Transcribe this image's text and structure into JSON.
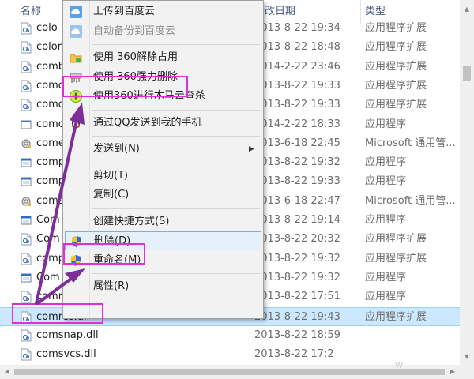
{
  "columns": {
    "name": "名称",
    "date": "修改日期",
    "type": "类型"
  },
  "files": [
    {
      "name": "colo",
      "date": "2013-8-22 19:34",
      "type": "应用程序扩展",
      "icon": "dll-icon"
    },
    {
      "name": "color",
      "date": "2013-8-22 18:48",
      "type": "应用程序扩展",
      "icon": "dll-icon"
    },
    {
      "name": "comb",
      "date": "2014-2-22 23:46",
      "type": "应用程序扩展",
      "icon": "dll-icon"
    },
    {
      "name": "comc",
      "date": "2013-8-22 19:33",
      "type": "应用程序扩展",
      "icon": "dll-icon"
    },
    {
      "name": "comc",
      "date": "2013-8-22 19:33",
      "type": "应用程序扩展",
      "icon": "dll-icon"
    },
    {
      "name": "comc",
      "date": "2014-2-22 18:33",
      "type": "应用程序",
      "icon": "exe-icon"
    },
    {
      "name": "come",
      "date": "2013-6-18 22:45",
      "type": "Microsoft 通用管...",
      "icon": "gear-file-icon"
    },
    {
      "name": "comp",
      "date": "2013-8-22 19:32",
      "type": "应用程序",
      "icon": "window-icon"
    },
    {
      "name": "comp",
      "date": "2013-8-22 19:33",
      "type": "应用程序",
      "icon": "window-icon"
    },
    {
      "name": "coms",
      "date": "2013-6-18 22:47",
      "type": "Microsoft 通用管...",
      "icon": "gear-file-icon"
    },
    {
      "name": "Com",
      "date": "2013-8-22 19:14",
      "type": "应用程序",
      "icon": "window-icon"
    },
    {
      "name": "Com",
      "date": "2013-8-22 20:32",
      "type": "应用程序扩展",
      "icon": "dll-icon"
    },
    {
      "name": "comp",
      "date": "2013-8-22 19:32",
      "type": "应用程序扩展",
      "icon": "dll-icon"
    },
    {
      "name": "Com",
      "date": "2013-8-22 19:32",
      "type": "应用程序",
      "icon": "window-icon"
    },
    {
      "name": "comr",
      "date": "2013-8-22 17:51",
      "type": "应用程序",
      "icon": "dll-icon"
    },
    {
      "name": "comres.dll",
      "date": "2013-8-22 19:43",
      "type": "应用程序扩展",
      "icon": "dll-icon",
      "selected": true
    },
    {
      "name": "comsnap.dll",
      "date": "2013-8-22 18:59",
      "type": "",
      "icon": "dll-icon"
    },
    {
      "name": "comsvcs.dll",
      "date": "2013-8-22 17:2",
      "type": "",
      "icon": "dll-icon"
    }
  ],
  "context_menu": {
    "items": [
      {
        "label": "上传到百度云",
        "icon": "baidu-cloud-icon"
      },
      {
        "label": "自动备份到百度云",
        "icon": "baidu-backup-icon",
        "disabled": true
      },
      {
        "sep": true
      },
      {
        "label": "使用 360解除占用",
        "icon": "360-folder-icon"
      },
      {
        "label": "使用 360强力删除",
        "icon": "shredder-icon"
      },
      {
        "label": "使用360进行木马云查杀",
        "icon": "360-shield-icon"
      },
      {
        "sep": true
      },
      {
        "label": "通过QQ发送到我的手机",
        "icon": "qq-icon"
      },
      {
        "sep": true
      },
      {
        "label": "发送到(N)",
        "submenu": true
      },
      {
        "sep": true
      },
      {
        "label": "剪切(T)"
      },
      {
        "label": "复制(C)"
      },
      {
        "sep": true
      },
      {
        "label": "创建快捷方式(S)"
      },
      {
        "label": "删除(D)",
        "icon": "uac-shield-icon",
        "hover": true
      },
      {
        "label": "重命名(M)",
        "icon": "uac-shield-icon"
      },
      {
        "sep": true
      },
      {
        "label": "属性(R)"
      }
    ]
  },
  "colors": {
    "highlight": "#e22ed8",
    "arrow": "#7d2e9a",
    "selection": "#cce8ff",
    "menu_hover": "#e5f0fb"
  },
  "watermark": "W"
}
